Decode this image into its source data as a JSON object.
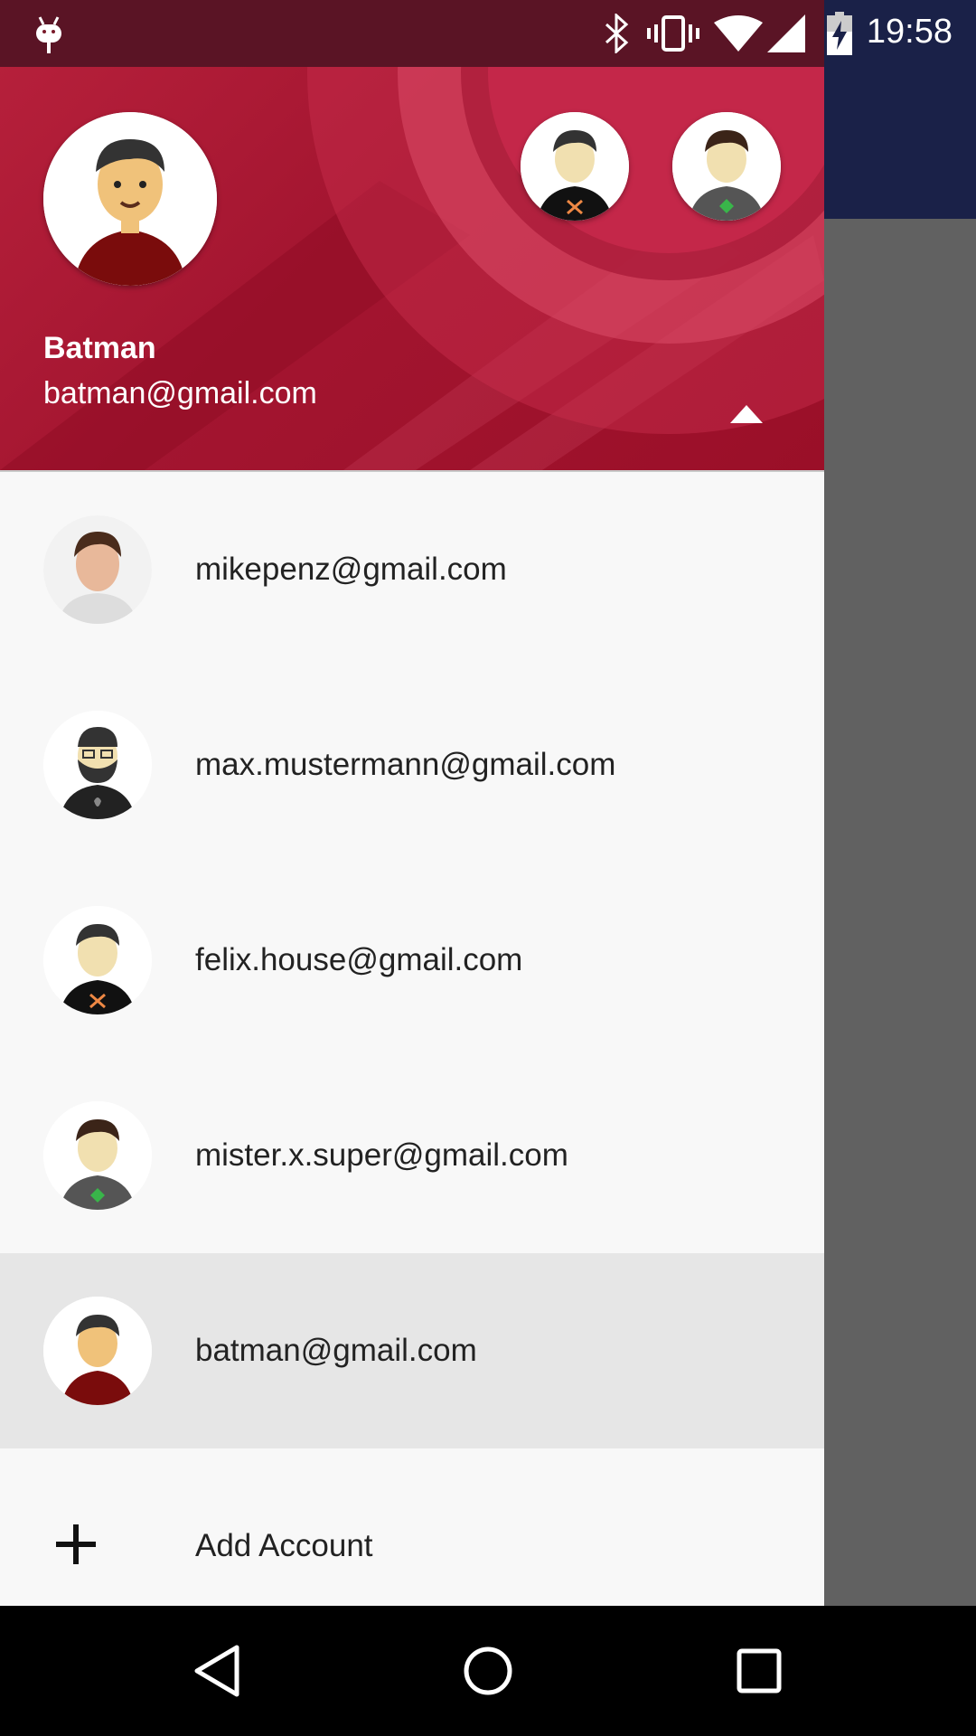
{
  "status_bar": {
    "time": "19:58",
    "icons": [
      "android-debug-icon",
      "bluetooth-icon",
      "vibrate-icon",
      "wifi-icon",
      "signal-icon",
      "battery-charging-icon"
    ]
  },
  "header": {
    "name": "Batman",
    "email": "batman@gmail.com",
    "toggle_icon": "arrow-up-icon",
    "colors": {
      "primary": "#a31530",
      "accent": "#d8405e"
    }
  },
  "accounts": [
    {
      "email": "mikepenz@gmail.com",
      "avatar": "photo-avatar",
      "selected": false
    },
    {
      "email": "max.mustermann@gmail.com",
      "avatar": "bearded-avatar",
      "selected": false
    },
    {
      "email": "felix.house@gmail.com",
      "avatar": "x-shirt-avatar",
      "selected": false
    },
    {
      "email": "mister.x.super@gmail.com",
      "avatar": "diamond-shirt-avatar",
      "selected": false
    },
    {
      "email": "batman@gmail.com",
      "avatar": "red-shirt-avatar",
      "selected": true
    }
  ],
  "add_account": {
    "label": "Add Account",
    "icon": "plus-icon"
  },
  "nav_bar": {
    "back": "back-icon",
    "home": "home-icon",
    "recents": "recents-icon"
  }
}
